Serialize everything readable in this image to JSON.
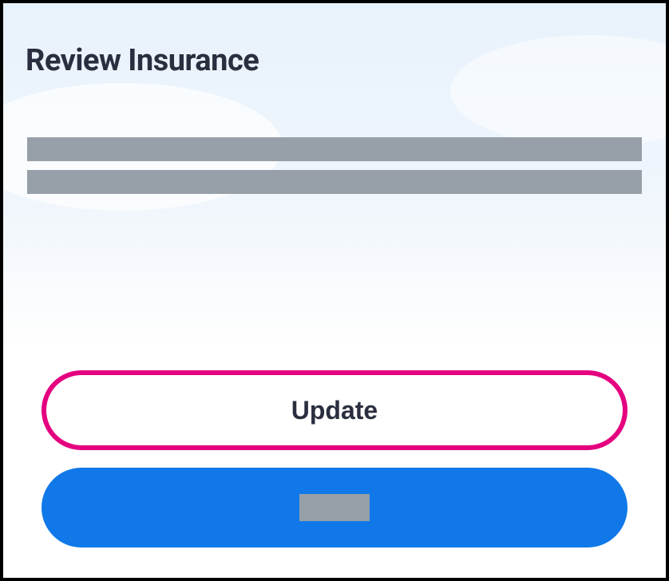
{
  "page": {
    "title": "Review Insurance"
  },
  "buttons": {
    "update_label": "Update",
    "primary_label": ""
  },
  "colors": {
    "accent_highlight": "#e4007f",
    "primary": "#1078e8",
    "placeholder": "#97a0a8",
    "text": "#2a2e3f"
  }
}
